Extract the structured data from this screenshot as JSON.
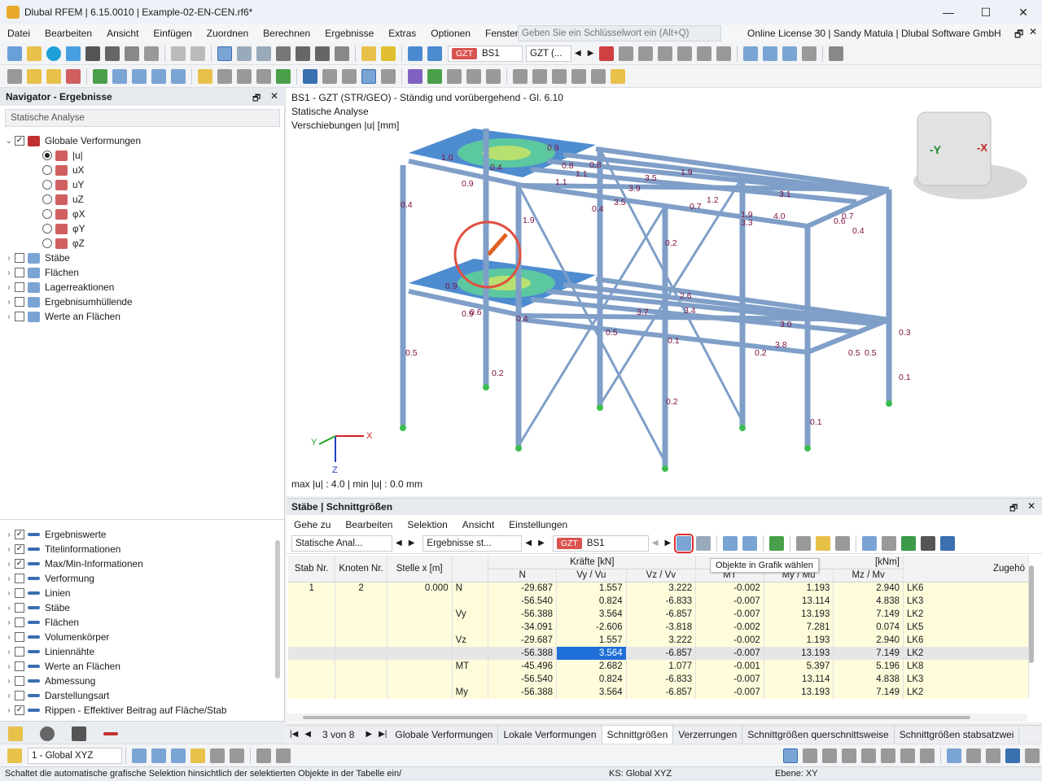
{
  "window": {
    "title": "Dlubal RFEM | 6.15.0010 | Example-02-EN-CEN.rf6*",
    "minimize": "—",
    "maximize": "☐",
    "close": "✕"
  },
  "menu": {
    "items": [
      "Datei",
      "Bearbeiten",
      "Ansicht",
      "Einfügen",
      "Zuordnen",
      "Berechnen",
      "Ergebnisse",
      "Extras",
      "Optionen",
      "Fenster"
    ],
    "overflow": "»",
    "search_placeholder": "Geben Sie ein Schlüsselwort ein (Alt+Q)",
    "license": "Online License 30 | Sandy Matula | Dlubal Software GmbH"
  },
  "toolbar": {
    "load_badge": "GZT",
    "load_case": "BS1",
    "load_combo": "GZT (..."
  },
  "navigator": {
    "title": "Navigator - Ergebnisse",
    "analysis_select": "Statische Analyse",
    "tree": [
      {
        "label": "Globale Verformungen",
        "type": "check",
        "checked": true,
        "expanded": true,
        "indent": 0
      },
      {
        "label": "|u|",
        "type": "radio",
        "checked": true,
        "indent": 1
      },
      {
        "label": "uX",
        "type": "radio",
        "checked": false,
        "indent": 1
      },
      {
        "label": "uY",
        "type": "radio",
        "checked": false,
        "indent": 1
      },
      {
        "label": "uZ",
        "type": "radio",
        "checked": false,
        "indent": 1
      },
      {
        "label": "φX",
        "type": "radio",
        "checked": false,
        "indent": 1
      },
      {
        "label": "φY",
        "type": "radio",
        "checked": false,
        "indent": 1
      },
      {
        "label": "φZ",
        "type": "radio",
        "checked": false,
        "indent": 1
      },
      {
        "label": "Stäbe",
        "type": "check",
        "checked": false,
        "indent": 0
      },
      {
        "label": "Flächen",
        "type": "check",
        "checked": false,
        "indent": 0
      },
      {
        "label": "Lagerreaktionen",
        "type": "check",
        "checked": false,
        "indent": 0
      },
      {
        "label": "Ergebnisumhüllende",
        "type": "check",
        "checked": false,
        "indent": 0
      },
      {
        "label": "Werte an Flächen",
        "type": "check",
        "checked": false,
        "indent": 0
      }
    ],
    "display_tree": [
      {
        "label": "Ergebniswerte",
        "checked": true
      },
      {
        "label": "Titelinformationen",
        "checked": true
      },
      {
        "label": "Max/Min-Informationen",
        "checked": true
      },
      {
        "label": "Verformung",
        "checked": false
      },
      {
        "label": "Linien",
        "checked": false
      },
      {
        "label": "Stäbe",
        "checked": false
      },
      {
        "label": "Flächen",
        "checked": false
      },
      {
        "label": "Volumenkörper",
        "checked": false
      },
      {
        "label": "Liniennähte",
        "checked": false
      },
      {
        "label": "Werte an Flächen",
        "checked": false
      },
      {
        "label": "Abmessung",
        "checked": false
      },
      {
        "label": "Darstellungsart",
        "checked": false
      },
      {
        "label": "Rippen - Effektiver Beitrag auf Fläche/Stab",
        "checked": true
      }
    ]
  },
  "viewport": {
    "info_line1": "BS1 - GZT (STR/GEO) - Ständig und vorübergehend - Gl. 6.10",
    "info_line2": "Statische Analyse",
    "info_line3": "Verschiebungen |u| [mm]",
    "maxmin": "max |u| : 4.0 | min |u| : 0.0 mm",
    "labels": [
      "1.0",
      "0.9",
      "0.4",
      "0.9",
      "0.4",
      "1.9",
      "0.4",
      "1.1",
      "0.8",
      "1.1",
      "3.5",
      "3.9",
      "3.5",
      "1.9",
      "1.2",
      "0.7",
      "3.1",
      "4.0",
      "3.3",
      "0.6",
      "0.4",
      "0.2",
      "0.9",
      "0.6",
      "0.9",
      "0.5",
      "0.4",
      "2.6",
      "3.7",
      "3.4",
      "3.0",
      "3.8",
      "0.5",
      "0.1",
      "0.5",
      "0.2",
      "0.2",
      "0.1",
      "0.1",
      "0.5",
      "0.3",
      "1.9",
      "0.8",
      "0.7",
      "0.2"
    ],
    "axes_x": "X",
    "axes_y": "Y",
    "axes_z": "Z",
    "cube_y": "-Y",
    "cube_x": "-X"
  },
  "table_panel": {
    "title": "Stäbe | Schnittgrößen",
    "menu": [
      "Gehe zu",
      "Bearbeiten",
      "Selektion",
      "Ansicht",
      "Einstellungen"
    ],
    "analysis": "Statische Anal...",
    "results": "Ergebnisse st...",
    "badge": "GZT",
    "case": "BS1",
    "tooltip": "Objekte in Grafik wählen",
    "group_forces": "Kräfte [kN]",
    "group_moments": "[kNm]",
    "columns": [
      "Stab Nr.",
      "Knoten Nr.",
      "Stelle x [m]",
      "",
      "N",
      "Vy / Vu",
      "Vz / Vv",
      "MT",
      "My / Mu",
      "Mz / Mv",
      "Zugehö"
    ],
    "rows": [
      {
        "stab": "1",
        "knoten": "2",
        "stelle": "0.000",
        "type": "N",
        "N": "-29.687",
        "Vy": "1.557",
        "Vz": "3.222",
        "MT": "-0.002",
        "My": "1.193",
        "Mz": "2.940",
        "lk": "LK6"
      },
      {
        "stab": "",
        "knoten": "",
        "stelle": "",
        "type": "",
        "N": "-56.540",
        "Vy": "0.824",
        "Vz": "-6.833",
        "MT": "-0.007",
        "My": "13.114",
        "Mz": "4.838",
        "lk": "LK3"
      },
      {
        "stab": "",
        "knoten": "",
        "stelle": "",
        "type": "Vy",
        "N": "-56.388",
        "Vy": "3.564",
        "Vz": "-6.857",
        "MT": "-0.007",
        "My": "13.193",
        "Mz": "7.149",
        "lk": "LK2"
      },
      {
        "stab": "",
        "knoten": "",
        "stelle": "",
        "type": "",
        "N": "-34.091",
        "Vy": "-2.606",
        "Vz": "-3.818",
        "MT": "-0.002",
        "My": "7.281",
        "Mz": "0.074",
        "lk": "LK5"
      },
      {
        "stab": "",
        "knoten": "",
        "stelle": "",
        "type": "Vz",
        "N": "-29.687",
        "Vy": "1.557",
        "Vz": "3.222",
        "MT": "-0.002",
        "My": "1.193",
        "Mz": "2.940",
        "lk": "LK6"
      },
      {
        "stab": "",
        "knoten": "",
        "stelle": "",
        "type": "",
        "N": "-56.388",
        "Vy": "3.564",
        "Vz": "-6.857",
        "MT": "-0.007",
        "My": "13.193",
        "Mz": "7.149",
        "lk": "LK2"
      },
      {
        "stab": "",
        "knoten": "",
        "stelle": "",
        "type": "MT",
        "N": "-45.496",
        "Vy": "2.682",
        "Vz": "1.077",
        "MT": "-0.001",
        "My": "5.397",
        "Mz": "5.196",
        "lk": "LK8"
      },
      {
        "stab": "",
        "knoten": "",
        "stelle": "",
        "type": "",
        "N": "-56.540",
        "Vy": "0.824",
        "Vz": "-6.833",
        "MT": "-0.007",
        "My": "13.114",
        "Mz": "4.838",
        "lk": "LK3"
      },
      {
        "stab": "",
        "knoten": "",
        "stelle": "",
        "type": "My",
        "N": "-56.388",
        "Vy": "3.564",
        "Vz": "-6.857",
        "MT": "-0.007",
        "My": "13.193",
        "Mz": "7.149",
        "lk": "LK2"
      }
    ],
    "pager": "3 von 8",
    "tabs": [
      "Globale Verformungen",
      "Lokale Verformungen",
      "Schnittgrößen",
      "Verzerrungen",
      "Schnittgrößen querschnittsweise",
      "Schnittgrößen stabsatzwei"
    ],
    "active_tab": "Schnittgrößen"
  },
  "bottom": {
    "view_select": "1 - Global XYZ"
  },
  "status": {
    "message": "Schaltet die automatische grafische Selektion hinsichtlich der selektierten Objekte in der Tabelle ein/",
    "ks": "KS: Global XYZ",
    "ebene": "Ebene: XY"
  },
  "colors": {
    "accent": "#d9534f",
    "steel": "#7f9fc8",
    "surface": "#2f78c8"
  }
}
